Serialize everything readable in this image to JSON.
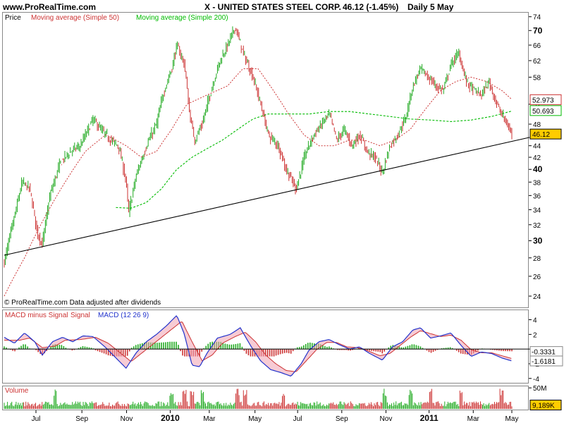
{
  "header": {
    "site": "www.ProRealTime.com",
    "title": "X - UNITED STATES STEEL CORP.",
    "quote": "46.12 (-1.45%)",
    "period": "Daily  5 May"
  },
  "colors": {
    "up": "#22aa22",
    "down": "#cc3333",
    "ma50": "#cc3333",
    "ma200": "#00bb00",
    "macd": "#2233cc",
    "signal": "#cc3333",
    "hist_up": "#22aa22",
    "hist_down": "#cc3333",
    "price_badge": "#ffcc00"
  },
  "chart_data": [
    {
      "type": "candlestick",
      "title": "Price",
      "legend": [
        "Moving average (Simple 50)",
        "Moving average (Simple 200)"
      ],
      "y_axis_side": "right",
      "ylim": [
        23,
        75
      ],
      "yticks": [
        24,
        26,
        28,
        30,
        32,
        34,
        36,
        38,
        40,
        42,
        44,
        48,
        52,
        58,
        62,
        66,
        70,
        74
      ],
      "yticks_bold": [
        30,
        40,
        70
      ],
      "x_tick_labels": [
        {
          "label": "Jul",
          "pos": 0.0625
        },
        {
          "label": "Sep",
          "pos": 0.153
        },
        {
          "label": "Nov",
          "pos": 0.241
        },
        {
          "label": "2010",
          "pos": 0.327,
          "bold": true
        },
        {
          "label": "Mar",
          "pos": 0.404
        },
        {
          "label": "May",
          "pos": 0.494
        },
        {
          "label": "Jul",
          "pos": 0.578
        },
        {
          "label": "Sep",
          "pos": 0.665
        },
        {
          "label": "Nov",
          "pos": 0.752
        },
        {
          "label": "2011",
          "pos": 0.837,
          "bold": true
        },
        {
          "label": "Mar",
          "pos": 0.924
        },
        {
          "label": "May",
          "pos": 1.0
        }
      ],
      "price_path": [
        {
          "t": 0.0,
          "v": 27.5
        },
        {
          "t": 0.02,
          "v": 33
        },
        {
          "t": 0.035,
          "v": 38
        },
        {
          "t": 0.05,
          "v": 37
        },
        {
          "t": 0.065,
          "v": 31
        },
        {
          "t": 0.075,
          "v": 29.5
        },
        {
          "t": 0.09,
          "v": 36
        },
        {
          "t": 0.11,
          "v": 41
        },
        {
          "t": 0.13,
          "v": 43
        },
        {
          "t": 0.15,
          "v": 44
        },
        {
          "t": 0.175,
          "v": 49
        },
        {
          "t": 0.19,
          "v": 47
        },
        {
          "t": 0.21,
          "v": 45
        },
        {
          "t": 0.225,
          "v": 44
        },
        {
          "t": 0.24,
          "v": 38
        },
        {
          "t": 0.245,
          "v": 33.5
        },
        {
          "t": 0.26,
          "v": 39
        },
        {
          "t": 0.28,
          "v": 44
        },
        {
          "t": 0.3,
          "v": 48
        },
        {
          "t": 0.315,
          "v": 55
        },
        {
          "t": 0.33,
          "v": 60
        },
        {
          "t": 0.34,
          "v": 66
        },
        {
          "t": 0.355,
          "v": 61
        },
        {
          "t": 0.365,
          "v": 50
        },
        {
          "t": 0.375,
          "v": 45
        },
        {
          "t": 0.39,
          "v": 48
        },
        {
          "t": 0.41,
          "v": 56
        },
        {
          "t": 0.425,
          "v": 62
        },
        {
          "t": 0.44,
          "v": 66
        },
        {
          "t": 0.455,
          "v": 71
        },
        {
          "t": 0.47,
          "v": 64
        },
        {
          "t": 0.49,
          "v": 58
        },
        {
          "t": 0.505,
          "v": 52
        },
        {
          "t": 0.52,
          "v": 46
        },
        {
          "t": 0.54,
          "v": 44
        },
        {
          "t": 0.555,
          "v": 40
        },
        {
          "t": 0.575,
          "v": 37
        },
        {
          "t": 0.595,
          "v": 43
        },
        {
          "t": 0.61,
          "v": 46
        },
        {
          "t": 0.625,
          "v": 48
        },
        {
          "t": 0.64,
          "v": 50
        },
        {
          "t": 0.655,
          "v": 45
        },
        {
          "t": 0.67,
          "v": 47
        },
        {
          "t": 0.685,
          "v": 44
        },
        {
          "t": 0.7,
          "v": 46
        },
        {
          "t": 0.715,
          "v": 43
        },
        {
          "t": 0.73,
          "v": 42
        },
        {
          "t": 0.745,
          "v": 39.5
        },
        {
          "t": 0.76,
          "v": 44
        },
        {
          "t": 0.775,
          "v": 46
        },
        {
          "t": 0.79,
          "v": 49
        },
        {
          "t": 0.805,
          "v": 56
        },
        {
          "t": 0.82,
          "v": 60
        },
        {
          "t": 0.835,
          "v": 58
        },
        {
          "t": 0.85,
          "v": 56
        },
        {
          "t": 0.865,
          "v": 55
        },
        {
          "t": 0.88,
          "v": 61
        },
        {
          "t": 0.895,
          "v": 64
        },
        {
          "t": 0.91,
          "v": 57
        },
        {
          "t": 0.925,
          "v": 55
        },
        {
          "t": 0.94,
          "v": 54
        },
        {
          "t": 0.955,
          "v": 57
        },
        {
          "t": 0.97,
          "v": 52
        },
        {
          "t": 0.985,
          "v": 49
        },
        {
          "t": 1.0,
          "v": 46.12
        }
      ],
      "ma50_path": [
        {
          "t": 0.0,
          "v": 24
        },
        {
          "t": 0.04,
          "v": 28
        },
        {
          "t": 0.08,
          "v": 33
        },
        {
          "t": 0.12,
          "v": 38
        },
        {
          "t": 0.16,
          "v": 43
        },
        {
          "t": 0.2,
          "v": 46
        },
        {
          "t": 0.24,
          "v": 44
        },
        {
          "t": 0.27,
          "v": 42
        },
        {
          "t": 0.3,
          "v": 43
        },
        {
          "t": 0.33,
          "v": 47
        },
        {
          "t": 0.36,
          "v": 52
        },
        {
          "t": 0.4,
          "v": 54
        },
        {
          "t": 0.44,
          "v": 56
        },
        {
          "t": 0.47,
          "v": 60
        },
        {
          "t": 0.5,
          "v": 60
        },
        {
          "t": 0.53,
          "v": 55
        },
        {
          "t": 0.56,
          "v": 50
        },
        {
          "t": 0.59,
          "v": 46
        },
        {
          "t": 0.62,
          "v": 44
        },
        {
          "t": 0.65,
          "v": 44
        },
        {
          "t": 0.68,
          "v": 45
        },
        {
          "t": 0.71,
          "v": 45
        },
        {
          "t": 0.74,
          "v": 44
        },
        {
          "t": 0.77,
          "v": 45
        },
        {
          "t": 0.8,
          "v": 47
        },
        {
          "t": 0.83,
          "v": 51
        },
        {
          "t": 0.86,
          "v": 55
        },
        {
          "t": 0.89,
          "v": 57
        },
        {
          "t": 0.92,
          "v": 58
        },
        {
          "t": 0.95,
          "v": 57
        },
        {
          "t": 0.98,
          "v": 55
        },
        {
          "t": 1.0,
          "v": 53
        }
      ],
      "ma200_path": [
        {
          "t": 0.22,
          "v": 34.3
        },
        {
          "t": 0.25,
          "v": 34.2
        },
        {
          "t": 0.28,
          "v": 35
        },
        {
          "t": 0.31,
          "v": 37
        },
        {
          "t": 0.34,
          "v": 40
        },
        {
          "t": 0.37,
          "v": 42
        },
        {
          "t": 0.4,
          "v": 43.5
        },
        {
          "t": 0.43,
          "v": 45
        },
        {
          "t": 0.46,
          "v": 47
        },
        {
          "t": 0.49,
          "v": 49
        },
        {
          "t": 0.52,
          "v": 50
        },
        {
          "t": 0.56,
          "v": 50
        },
        {
          "t": 0.6,
          "v": 50
        },
        {
          "t": 0.64,
          "v": 50.5
        },
        {
          "t": 0.68,
          "v": 50.5
        },
        {
          "t": 0.72,
          "v": 50
        },
        {
          "t": 0.76,
          "v": 49.5
        },
        {
          "t": 0.8,
          "v": 49
        },
        {
          "t": 0.84,
          "v": 48.8
        },
        {
          "t": 0.88,
          "v": 48.5
        },
        {
          "t": 0.92,
          "v": 48.8
        },
        {
          "t": 0.96,
          "v": 49.5
        },
        {
          "t": 1.0,
          "v": 50.6
        }
      ],
      "trendline": [
        {
          "t": 0.0,
          "v": 28.3
        },
        {
          "t": 1.035,
          "v": 45.5
        }
      ],
      "value_labels": [
        {
          "text": "52.973",
          "v": 52.973,
          "color": "#cc3333"
        },
        {
          "text": "50.693",
          "v": 50.693,
          "color": "#00bb00"
        },
        {
          "text": "46.12",
          "v": 46.12,
          "color": "#ffcc00"
        }
      ],
      "footnote": "© ProRealTime.com  Data adjusted after dividends"
    },
    {
      "type": "line",
      "title": "MACD minus Signal Signal MACD (12 26 9)",
      "title_parts": [
        "MACD minus Signal",
        "Signal",
        "MACD (12 26 9)"
      ],
      "ylim": [
        -4.5,
        5.2
      ],
      "yticks": [
        -4,
        -2,
        0,
        2,
        4
      ],
      "macd_path": [
        {
          "t": 0.0,
          "v": 1.6
        },
        {
          "t": 0.02,
          "v": 0.8
        },
        {
          "t": 0.04,
          "v": 2.2
        },
        {
          "t": 0.06,
          "v": 1.0
        },
        {
          "t": 0.075,
          "v": -0.8
        },
        {
          "t": 0.095,
          "v": 1.0
        },
        {
          "t": 0.115,
          "v": 1.6
        },
        {
          "t": 0.135,
          "v": 1.0
        },
        {
          "t": 0.155,
          "v": 1.8
        },
        {
          "t": 0.175,
          "v": 1.7
        },
        {
          "t": 0.2,
          "v": 0.2
        },
        {
          "t": 0.22,
          "v": -1.2
        },
        {
          "t": 0.24,
          "v": -2.6
        },
        {
          "t": 0.26,
          "v": -0.5
        },
        {
          "t": 0.28,
          "v": 1.0
        },
        {
          "t": 0.3,
          "v": 2.0
        },
        {
          "t": 0.32,
          "v": 3.2
        },
        {
          "t": 0.34,
          "v": 4.6
        },
        {
          "t": 0.355,
          "v": 2.0
        },
        {
          "t": 0.37,
          "v": -2.2
        },
        {
          "t": 0.385,
          "v": -2.4
        },
        {
          "t": 0.4,
          "v": -0.5
        },
        {
          "t": 0.42,
          "v": 1.5
        },
        {
          "t": 0.445,
          "v": 2.0
        },
        {
          "t": 0.465,
          "v": 2.9
        },
        {
          "t": 0.485,
          "v": 0.5
        },
        {
          "t": 0.505,
          "v": -1.6
        },
        {
          "t": 0.525,
          "v": -2.8
        },
        {
          "t": 0.545,
          "v": -3.2
        },
        {
          "t": 0.565,
          "v": -3.7
        },
        {
          "t": 0.585,
          "v": -2.0
        },
        {
          "t": 0.6,
          "v": -0.2
        },
        {
          "t": 0.62,
          "v": 1.0
        },
        {
          "t": 0.64,
          "v": 1.3
        },
        {
          "t": 0.66,
          "v": 0.6
        },
        {
          "t": 0.68,
          "v": 0.0
        },
        {
          "t": 0.7,
          "v": 0.3
        },
        {
          "t": 0.72,
          "v": -0.6
        },
        {
          "t": 0.745,
          "v": -1.5
        },
        {
          "t": 0.765,
          "v": 0.3
        },
        {
          "t": 0.785,
          "v": 1.0
        },
        {
          "t": 0.805,
          "v": 2.6
        },
        {
          "t": 0.82,
          "v": 2.9
        },
        {
          "t": 0.84,
          "v": 1.5
        },
        {
          "t": 0.86,
          "v": 1.8
        },
        {
          "t": 0.88,
          "v": 2.2
        },
        {
          "t": 0.9,
          "v": 0.5
        },
        {
          "t": 0.92,
          "v": -1.0
        },
        {
          "t": 0.94,
          "v": -0.4
        },
        {
          "t": 0.96,
          "v": -0.6
        },
        {
          "t": 0.98,
          "v": -1.2
        },
        {
          "t": 1.0,
          "v": -1.6181
        }
      ],
      "signal_path": [
        {
          "t": 0.0,
          "v": 1.2
        },
        {
          "t": 0.03,
          "v": 1.2
        },
        {
          "t": 0.05,
          "v": 1.5
        },
        {
          "t": 0.075,
          "v": 0.2
        },
        {
          "t": 0.1,
          "v": 0.4
        },
        {
          "t": 0.12,
          "v": 1.2
        },
        {
          "t": 0.15,
          "v": 1.3
        },
        {
          "t": 0.18,
          "v": 1.6
        },
        {
          "t": 0.205,
          "v": 0.8
        },
        {
          "t": 0.23,
          "v": -0.6
        },
        {
          "t": 0.25,
          "v": -1.7
        },
        {
          "t": 0.27,
          "v": -0.6
        },
        {
          "t": 0.29,
          "v": 0.5
        },
        {
          "t": 0.31,
          "v": 1.6
        },
        {
          "t": 0.33,
          "v": 2.7
        },
        {
          "t": 0.35,
          "v": 3.8
        },
        {
          "t": 0.37,
          "v": 1.0
        },
        {
          "t": 0.39,
          "v": -1.6
        },
        {
          "t": 0.41,
          "v": -0.8
        },
        {
          "t": 0.43,
          "v": 0.8
        },
        {
          "t": 0.455,
          "v": 1.7
        },
        {
          "t": 0.475,
          "v": 2.3
        },
        {
          "t": 0.495,
          "v": 1.0
        },
        {
          "t": 0.515,
          "v": -0.8
        },
        {
          "t": 0.535,
          "v": -2.0
        },
        {
          "t": 0.555,
          "v": -2.9
        },
        {
          "t": 0.575,
          "v": -3.1
        },
        {
          "t": 0.595,
          "v": -1.6
        },
        {
          "t": 0.615,
          "v": -0.1
        },
        {
          "t": 0.635,
          "v": 0.9
        },
        {
          "t": 0.655,
          "v": 0.9
        },
        {
          "t": 0.675,
          "v": 0.3
        },
        {
          "t": 0.695,
          "v": 0.2
        },
        {
          "t": 0.715,
          "v": -0.2
        },
        {
          "t": 0.74,
          "v": -0.9
        },
        {
          "t": 0.76,
          "v": -0.6
        },
        {
          "t": 0.78,
          "v": 0.5
        },
        {
          "t": 0.8,
          "v": 1.6
        },
        {
          "t": 0.82,
          "v": 2.5
        },
        {
          "t": 0.84,
          "v": 2.1
        },
        {
          "t": 0.86,
          "v": 1.7
        },
        {
          "t": 0.88,
          "v": 1.9
        },
        {
          "t": 0.9,
          "v": 1.2
        },
        {
          "t": 0.92,
          "v": -0.1
        },
        {
          "t": 0.94,
          "v": -0.5
        },
        {
          "t": 0.96,
          "v": -0.5
        },
        {
          "t": 0.98,
          "v": -0.9
        },
        {
          "t": 1.0,
          "v": -1.285
        }
      ],
      "value_labels": [
        {
          "text": "-0.3331",
          "v": -0.3331
        },
        {
          "text": "-1.6181",
          "v": -1.6181
        }
      ]
    },
    {
      "type": "bar",
      "title": "Volume",
      "ylim": [
        0,
        52
      ],
      "yticks_labels": [
        {
          "text": "50M",
          "v": 50
        }
      ],
      "value_label": {
        "text": "9,189K",
        "v": 9.189,
        "color": "#ffcc00"
      },
      "spike_positions": [
        0.1,
        0.33,
        0.355,
        0.37,
        0.39,
        0.46,
        0.475,
        0.55,
        0.75,
        0.8,
        0.84,
        0.9,
        0.98
      ]
    }
  ]
}
